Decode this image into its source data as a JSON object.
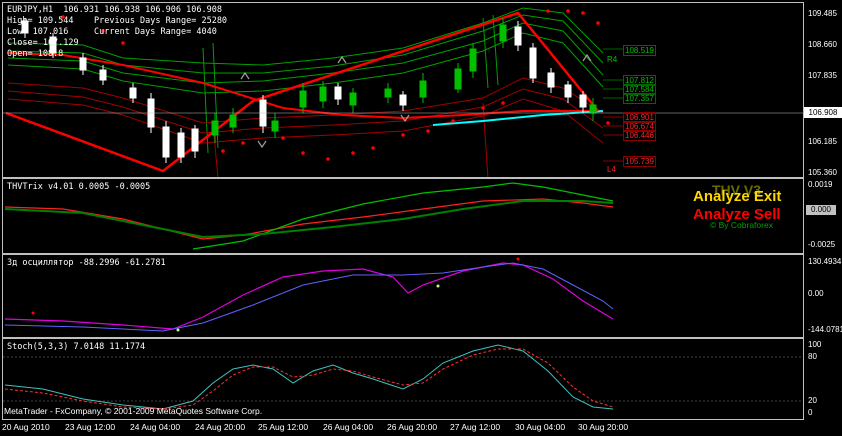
{
  "main_info": {
    "line1": "EURJPY,H1  106.931 106.938 106.906 106.908",
    "line2": "High= 109.544    Previous Days Range= 25280",
    "line3": "Low= 107.016     Current Days Range= 4040",
    "line4": "Close= 107.129",
    "line5": "Open= 108.8"
  },
  "main_scale": [
    "109.485",
    "108.660",
    "107.835",
    "106.908",
    "106.185",
    "105.360"
  ],
  "current_price": "106.908",
  "levels": {
    "green": [
      "108.519",
      "107.812",
      "107.584",
      "107.357"
    ],
    "red": [
      "106.901",
      "106.674",
      "106.446",
      "105.739"
    ],
    "r_marker": "R4",
    "l_marker": "L4"
  },
  "thv_panel": {
    "label": "THVTrix v4.01 0.0005 -0.0005",
    "scale": [
      "0.0019",
      "-0.0025"
    ],
    "box_value": "0.000",
    "analyze_exit": "Analyze Exit",
    "analyze_sell": "Analyze Sell",
    "thv_v3": "THV V3",
    "by": "© By Cobraforex"
  },
  "osc_panel": {
    "label": "3д осциллятор -88.2996 -61.2781",
    "scale": [
      "130.4934",
      "0.00",
      "-144.0781"
    ]
  },
  "stoch_panel": {
    "label": "Stoch(5,3,3) 7.0148 11.1774",
    "scale": [
      "100",
      "80",
      "20",
      "0"
    ]
  },
  "x_axis": [
    "20 Aug 2010",
    "23 Aug 12:00",
    "24 Aug 04:00",
    "24 Aug 20:00",
    "25 Aug 12:00",
    "26 Aug 04:00",
    "26 Aug 20:00",
    "27 Aug 12:00",
    "30 Aug 04:00",
    "30 Aug 20:00"
  ],
  "copyright": "MetaTrader - FxCompany, © 2001-2009 MetaQuotes Software Corp.",
  "colors": {
    "bull": "#00c000",
    "bear": "#ffffff",
    "zigzag": "#ff0000",
    "ma": "#00ffff"
  }
}
